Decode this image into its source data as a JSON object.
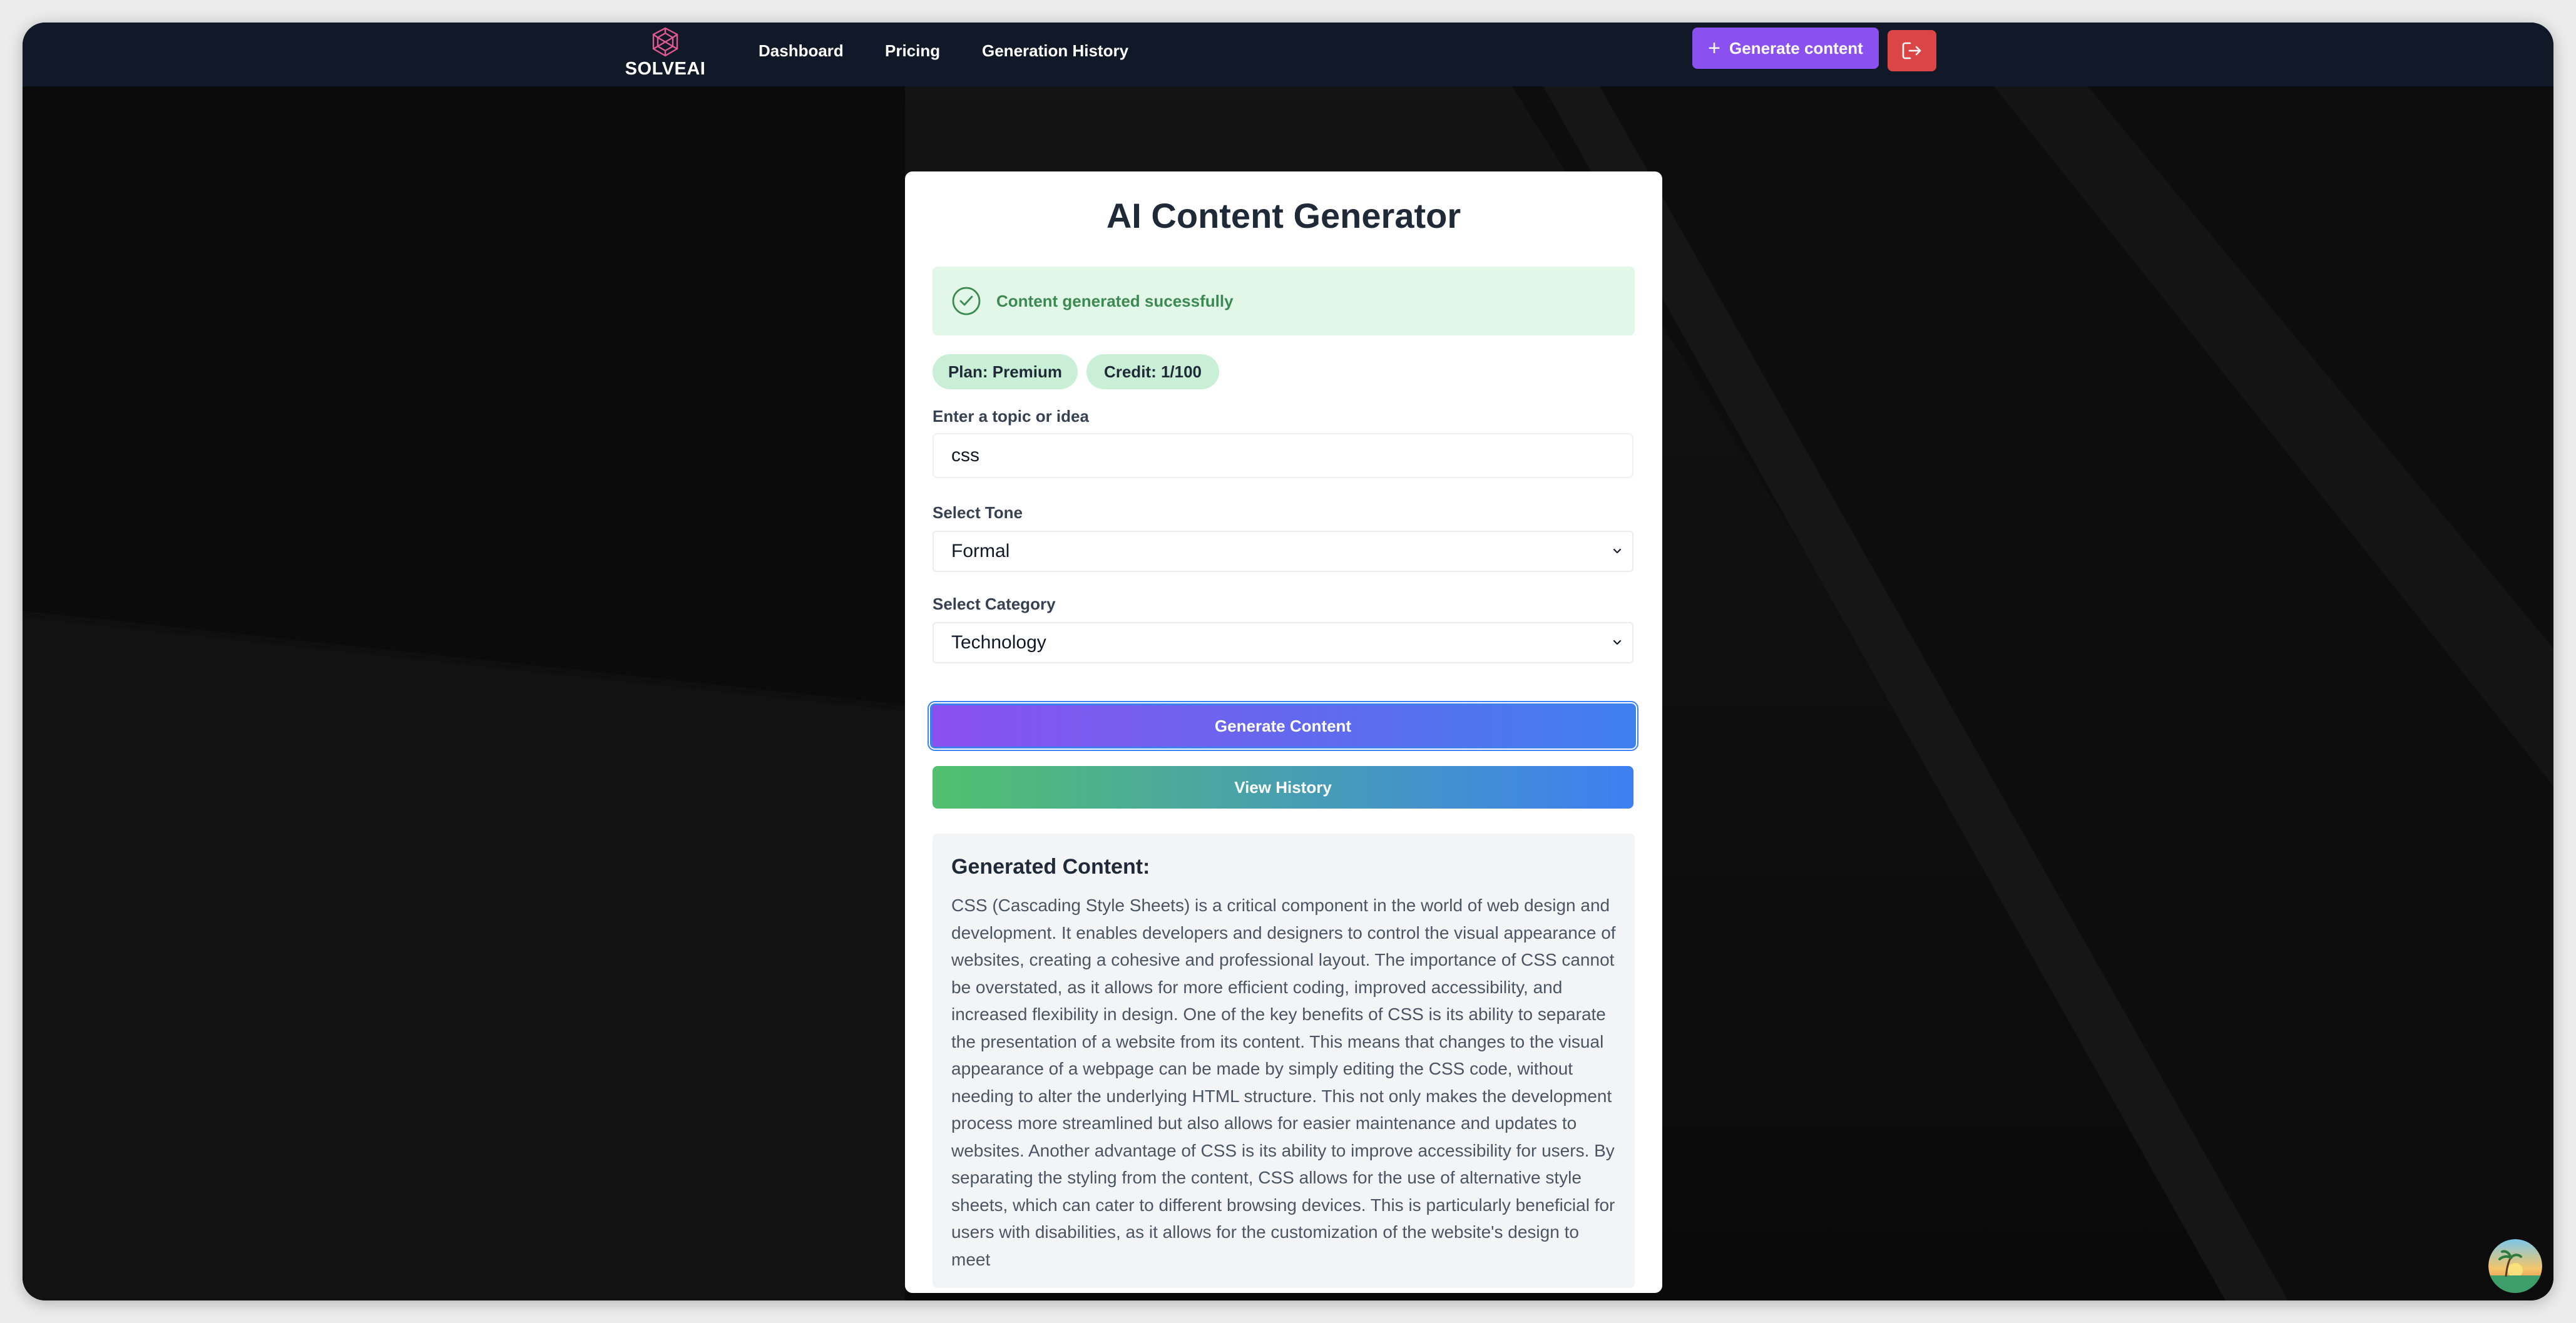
{
  "brand": {
    "name": "SOLVEAI"
  },
  "nav": {
    "links": [
      "Dashboard",
      "Pricing",
      "Generation History"
    ],
    "generate_button": "Generate content"
  },
  "card": {
    "title": "AI Content Generator",
    "alert": "Content generated sucessfully",
    "plan_badge": "Plan: Premium",
    "credit_badge": "Credit: 1/100",
    "topic_label": "Enter a topic or idea",
    "topic_value": "css",
    "tone_label": "Select Tone",
    "tone_value": "Formal",
    "category_label": "Select Category",
    "category_value": "Technology",
    "generate_button": "Generate Content",
    "history_button": "View History",
    "generated_title": "Generated Content:",
    "generated_text": "CSS (Cascading Style Sheets) is a critical component in the world of web design and development. It enables developers and designers to control the visual appearance of websites, creating a cohesive and professional layout. The importance of CSS cannot be overstated, as it allows for more efficient coding, improved accessibility, and increased flexibility in design. One of the key benefits of CSS is its ability to separate the presentation of a website from its content. This means that changes to the visual appearance of a webpage can be made by simply editing the CSS code, without needing to alter the underlying HTML structure. This not only makes the development process more streamlined but also allows for easier maintenance and updates to websites. Another advantage of CSS is its ability to improve accessibility for users. By separating the styling from the content, CSS allows for the use of alternative style sheets, which can cater to different browsing devices. This is particularly beneficial for users with disabilities, as it allows for the customization of the website's design to meet"
  },
  "colors": {
    "navbar_bg": "#111827",
    "accent_purple": "#8b50f0",
    "accent_blue": "#3f7fee",
    "accent_green": "#52c06d",
    "logout_red": "#dc4545",
    "success_bg": "#e3f7e8",
    "success_text": "#3a8a52",
    "badge_bg": "#c9f0d6"
  },
  "icons": {
    "logo": "solveai-logo-icon",
    "plus": "plus-icon",
    "logout": "logout-icon",
    "success": "check-circle-icon",
    "select": "chevron-down-icon"
  }
}
